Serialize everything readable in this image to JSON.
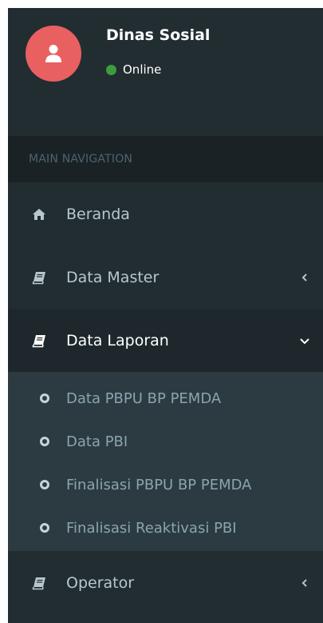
{
  "user": {
    "name": "Dinas Sosial",
    "status": "Online"
  },
  "nav": {
    "header": "MAIN NAVIGATION",
    "items": [
      {
        "label": "Beranda",
        "icon": "home-icon"
      },
      {
        "label": "Data Master",
        "icon": "book-icon",
        "caret": "chevron-left-icon"
      },
      {
        "label": "Data Laporan",
        "icon": "book-icon",
        "caret": "chevron-down-icon",
        "active": true,
        "children": [
          {
            "label": "Data PBPU BP PEMDA"
          },
          {
            "label": "Data PBI"
          },
          {
            "label": "Finalisasi PBPU BP PEMDA"
          },
          {
            "label": "Finalisasi Reaktivasi PBI"
          }
        ]
      },
      {
        "label": "Operator",
        "icon": "book-icon",
        "caret": "chevron-left-icon"
      }
    ]
  },
  "colors": {
    "sidebar_bg": "#222d32",
    "avatar_bg": "#e86060",
    "online_dot": "#3c9d3c",
    "submenu_bg": "#2c3b41"
  }
}
